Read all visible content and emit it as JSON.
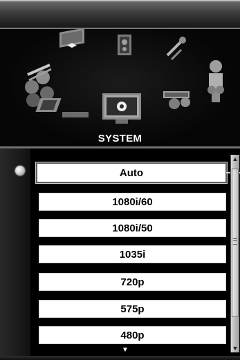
{
  "menu": {
    "current_category": "SYSTEM",
    "icons": [
      "color-balls-icon",
      "picture-move-icon",
      "speaker-icon",
      "wrench-icon",
      "person-icon",
      "laptop-icon",
      "system-monitor-icon",
      "video-connector-icon"
    ]
  },
  "list": {
    "options": [
      {
        "label": "Auto",
        "selected": true
      },
      {
        "label": "1080i/60",
        "selected": false
      },
      {
        "label": "1080i/50",
        "selected": false
      },
      {
        "label": "1035i",
        "selected": false
      },
      {
        "label": "720p",
        "selected": false
      },
      {
        "label": "575p",
        "selected": false
      },
      {
        "label": "480p",
        "selected": false
      }
    ],
    "scroll_up_icon": "scroll-up-arrow-icon",
    "scroll_down_icon": "scroll-down-arrow-icon",
    "more_indicator_icon": "more-items-arrow-icon"
  },
  "colors": {
    "background": "#000000",
    "option_bg": "#ffffff",
    "selected_border": "#5f5f5f"
  }
}
